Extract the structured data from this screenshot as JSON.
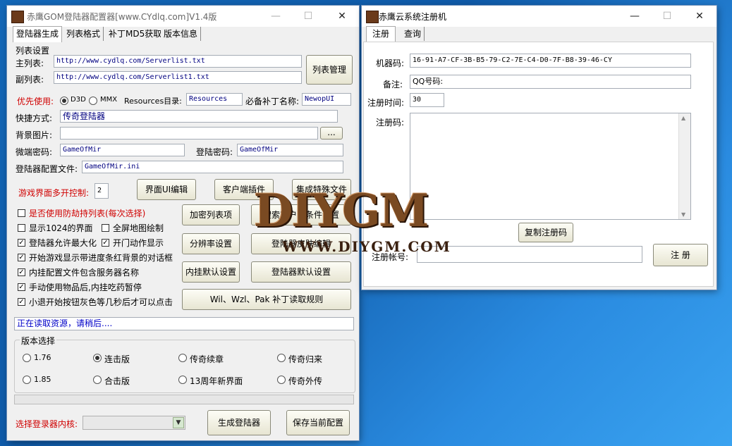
{
  "left_window": {
    "title": "赤鹰GOM登陆器配置器[www.CYdlq.com]V1.4版",
    "tabs": [
      "登陆器生成",
      "列表格式",
      "补丁MD5获取",
      "版本信息"
    ],
    "list_settings": "列表设置",
    "main_list_label": "主列表:",
    "main_list_value": "http://www.cydlq.com/Serverlist.txt",
    "sub_list_label": "副列表:",
    "sub_list_value": "http://www.cydlq.com/Serverlist1.txt",
    "list_manage_btn": "列表管理",
    "priority_label": "优先使用:",
    "d3d_label": "D3D",
    "mmx_label": "MMX",
    "resources_label": "Resources目录:",
    "resources_value": "Resources",
    "patch_name_label": "必备补丁名称:",
    "patch_name_value": "NewopUI",
    "shortcut_label": "快捷方式:",
    "shortcut_value": "传奇登陆器",
    "bg_label": "背景图片:",
    "bg_value": "",
    "browse_btn": "...",
    "micro_pwd_label": "微端密码:",
    "micro_pwd_value": "GameOfMir",
    "login_pwd_label": "登陆密码:",
    "login_pwd_value": "GameOfMir",
    "config_file_label": "登陆器配置文件:",
    "config_file_value": "GameOfMir.ini",
    "multi_open_label": "游戏界面多开控制:",
    "multi_open_value": "2",
    "ui_edit_btn": "界面UI编辑",
    "client_plugin_btn": "客户端插件",
    "special_file_btn": "集成特殊文件",
    "checkboxes": [
      {
        "label": "是否使用防劫持列表(每次选择)",
        "checked": false,
        "red": true
      },
      {
        "label": "显示1024的界面",
        "checked": false,
        "red": false
      },
      {
        "label": "登陆器允许最大化",
        "checked": true,
        "red": false
      },
      {
        "label": "开始游戏显示带进度条红背景的对话框",
        "checked": true,
        "red": false
      },
      {
        "label": "内挂配置文件包含服务器名称",
        "checked": true,
        "red": false
      },
      {
        "label": "手动使用物品后,内挂吃药暂停",
        "checked": true,
        "red": false
      },
      {
        "label": "小退开始按钮灰色等几秒后才可以点击",
        "checked": true,
        "red": false
      }
    ],
    "fullscreen_map_label": "全屏地图绘制",
    "open_door_label": "开门动作显示",
    "encrypt_list_btn": "加密列表项",
    "search_conditions_btn": "搜索客户端条件设置",
    "resolution_btn": "分辨率设置",
    "skin_edit_btn": "登陆器皮肤编辑",
    "inner_default_btn": "内挂默认设置",
    "login_default_btn": "登陆器默认设置",
    "patch_rule_btn": "Wil、Wzl、Pak 补丁读取规则",
    "status_text": "正在读取资源，请稍后....",
    "version_group": "版本选择",
    "versions": [
      {
        "label": "1.76",
        "selected": false
      },
      {
        "label": "连击版",
        "selected": true
      },
      {
        "label": "传奇续章",
        "selected": false
      },
      {
        "label": "传奇归来",
        "selected": false
      },
      {
        "label": "1.85",
        "selected": false
      },
      {
        "label": "合击版",
        "selected": false
      },
      {
        "label": "13周年新界面",
        "selected": false
      },
      {
        "label": "传奇外传",
        "selected": false
      }
    ],
    "core_label": "选择登录器内核:",
    "core_value": "",
    "generate_btn": "生成登陆器",
    "save_btn": "保存当前配置"
  },
  "right_window": {
    "title": "赤鹰云系统注册机",
    "tabs": [
      "注册",
      "查询"
    ],
    "machine_label": "机器码:",
    "machine_value": "16-91-A7-CF-3B-B5-79-C2-7E-C4-D0-7F-B8-39-46-CY",
    "remark_label": "备注:",
    "remark_value": "QQ号码:",
    "reg_time_label": "注册时间:",
    "reg_time_value": "30",
    "reg_code_label": "注册码:",
    "copy_btn": "复制注册码",
    "reg_account_label": "注册帐号:",
    "reg_account_value": "",
    "register_btn": "注 册"
  },
  "watermark": {
    "big": "DIYGM",
    "url": "WWW.DIYGM.COM"
  },
  "window_controls": {
    "minimize": "—",
    "maximize": "☐",
    "close": "✕"
  }
}
